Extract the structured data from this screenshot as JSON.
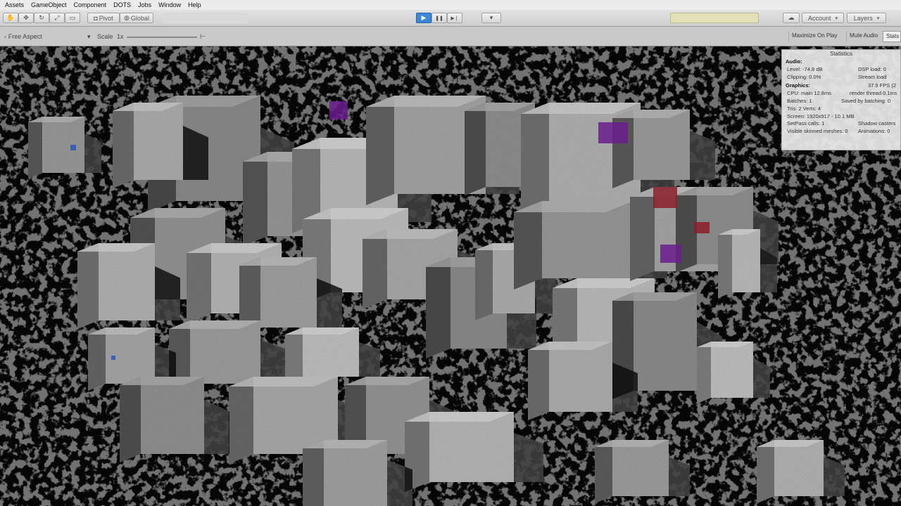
{
  "menu": {
    "items": [
      "Assets",
      "GameObject",
      "Component",
      "DOTS",
      "Jobs",
      "Window",
      "Help"
    ]
  },
  "toolbar": {
    "pivot_label": "Pivot",
    "global_label": "Global",
    "account_label": "Account",
    "layers_label": "Layers",
    "play_glyph": "▶",
    "pause_glyph": "❚❚",
    "step_glyph": "▶❘"
  },
  "gameview": {
    "aspect_label": "Free Aspect",
    "scale_label": "Scale",
    "scale_value": "1x",
    "maximize_on_play": "Maximize On Play",
    "mute_audio": "Mute Audio",
    "stats": "Stats"
  },
  "statistics": {
    "title": "Statistics",
    "audio_header": "Audio:",
    "audio_rows": [
      {
        "left": "Level: -74.8 dB",
        "right": "DSP load: 0"
      },
      {
        "left": "Clipping: 0.0%",
        "right": "Stream load"
      }
    ],
    "graphics_header": "Graphics:",
    "graphics_fps": "37.9 FPS (2",
    "graphics_rows": [
      {
        "left": "CPU: main 12.8ms",
        "right": "render thread 0.1ms"
      },
      {
        "left": "Batches: 1",
        "right": "Saved by batching: 0"
      },
      {
        "left": "Tris: 2   Verts: 4",
        "right": ""
      },
      {
        "left": "Screen: 1920x917 - 10.1 MB",
        "right": ""
      },
      {
        "left": "SetPass calls: 1",
        "right": "Shadow casters"
      },
      {
        "left": "Visible skinned meshes: 0",
        "right": "Animations: 0"
      }
    ]
  },
  "colors": {
    "accent": "#3a86d8",
    "menubar_bg": "#ececec",
    "toolbar_bg": "#d6d6d6",
    "stats_bg": "#e8e8e8",
    "highlight_purple": "#6a1d8c",
    "highlight_red": "#8a1e2c"
  }
}
